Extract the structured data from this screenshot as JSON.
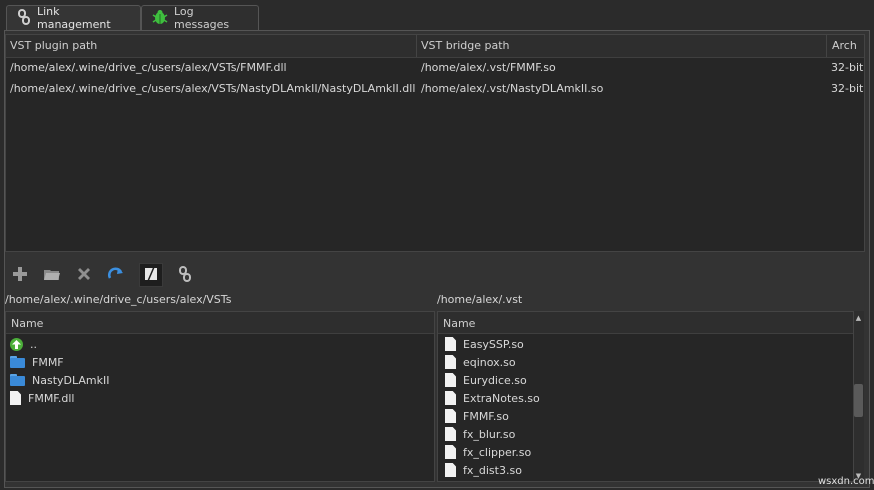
{
  "tabs": [
    {
      "label": "Link management",
      "icon": "link-icon",
      "active": true
    },
    {
      "label": "Log messages",
      "icon": "bug-icon",
      "active": false
    }
  ],
  "link_table": {
    "columns": [
      "VST plugin path",
      "VST bridge path",
      "Arch"
    ],
    "rows": [
      {
        "plugin": "/home/alex/.wine/drive_c/users/alex/VSTs/FMMF.dll",
        "bridge": "/home/alex/.vst/FMMF.so",
        "arch": "32-bit"
      },
      {
        "plugin": "/home/alex/.wine/drive_c/users/alex/VSTs/NastyDLAmkII/NastyDLAmkII.dll",
        "bridge": "/home/alex/.vst/NastyDLAmkII.so",
        "arch": "32-bit"
      }
    ]
  },
  "toolbar": {
    "buttons": [
      "add-icon",
      "open-folder-icon",
      "delete-icon",
      "refresh-icon",
      "edit-icon",
      "link-icon"
    ]
  },
  "left_pane": {
    "path": "/home/alex/.wine/drive_c/users/alex/VSTs",
    "header": "Name",
    "items": [
      {
        "name": "..",
        "type": "up"
      },
      {
        "name": "FMMF",
        "type": "folder"
      },
      {
        "name": "NastyDLAmkII",
        "type": "folder"
      },
      {
        "name": "FMMF.dll",
        "type": "file"
      }
    ]
  },
  "right_pane": {
    "path": "/home/alex/.vst",
    "header": "Name",
    "items": [
      {
        "name": "EasySSP.so",
        "type": "file"
      },
      {
        "name": "eqinox.so",
        "type": "file"
      },
      {
        "name": "Eurydice.so",
        "type": "file"
      },
      {
        "name": "ExtraNotes.so",
        "type": "file"
      },
      {
        "name": "FMMF.so",
        "type": "file"
      },
      {
        "name": "fx_blur.so",
        "type": "file"
      },
      {
        "name": "fx_clipper.so",
        "type": "file"
      },
      {
        "name": "fx_dist3.so",
        "type": "file"
      }
    ]
  },
  "watermark": "wsxdn.com"
}
